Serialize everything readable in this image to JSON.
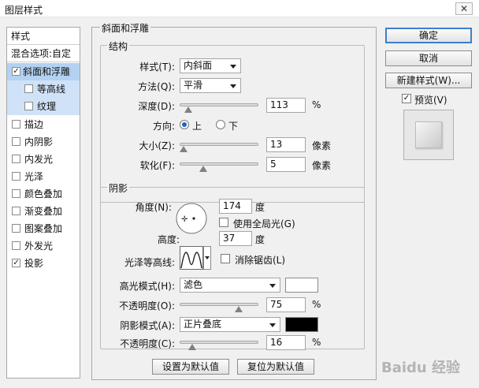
{
  "window": {
    "title": "图层样式",
    "close_label": "✕"
  },
  "sidebar": {
    "header": "样式",
    "blend_options": "混合选项:自定",
    "items": [
      {
        "label": "斜面和浮雕",
        "checked": true
      },
      {
        "label": "等高线",
        "checked": false
      },
      {
        "label": "纹理",
        "checked": false
      },
      {
        "label": "描边",
        "checked": false
      },
      {
        "label": "内阴影",
        "checked": false
      },
      {
        "label": "内发光",
        "checked": false
      },
      {
        "label": "光泽",
        "checked": false
      },
      {
        "label": "颜色叠加",
        "checked": false
      },
      {
        "label": "渐变叠加",
        "checked": false
      },
      {
        "label": "图案叠加",
        "checked": false
      },
      {
        "label": "外发光",
        "checked": false
      },
      {
        "label": "投影",
        "checked": true
      }
    ]
  },
  "panel": {
    "title": "斜面和浮雕",
    "structure": {
      "title": "结构",
      "style_label": "样式(T):",
      "style_value": "内斜面",
      "technique_label": "方法(Q):",
      "technique_value": "平滑",
      "depth_label": "深度(D):",
      "depth_value": "113",
      "depth_unit": "%",
      "depth_level": 0.113,
      "direction_label": "方向:",
      "direction_up": "上",
      "direction_down": "下",
      "size_label": "大小(Z):",
      "size_value": "13",
      "size_unit": "像素",
      "size_level": 0.05,
      "soften_label": "软化(F):",
      "soften_value": "5",
      "soften_unit": "像素",
      "soften_level": 0.3
    },
    "shading": {
      "title": "阴影",
      "angle_label": "角度(N):",
      "angle_value": "174",
      "angle_unit": "度",
      "global_light_label": "使用全局光(G)",
      "altitude_label": "高度:",
      "altitude_value": "37",
      "altitude_unit": "度",
      "gloss_contour_label": "光泽等高线:",
      "anti_aliased_label": "消除锯齿(L)",
      "highlight_mode_label": "高光模式(H):",
      "highlight_mode_value": "滤色",
      "highlight_color": "#ffffff",
      "highlight_opacity_label": "不透明度(O):",
      "highlight_opacity_value": "75",
      "highlight_opacity_unit": "%",
      "highlight_opacity_level": 0.75,
      "shadow_mode_label": "阴影模式(A):",
      "shadow_mode_value": "正片叠底",
      "shadow_color": "#000000",
      "shadow_opacity_label": "不透明度(C):",
      "shadow_opacity_value": "16",
      "shadow_opacity_unit": "%",
      "shadow_opacity_level": 0.16
    },
    "make_default": "设置为默认值",
    "reset_default": "复位为默认值"
  },
  "buttons": {
    "ok": "确定",
    "cancel": "取消",
    "new_style": "新建样式(W)...",
    "preview_label": "预览(V)"
  },
  "watermark": "Baidu 经验"
}
